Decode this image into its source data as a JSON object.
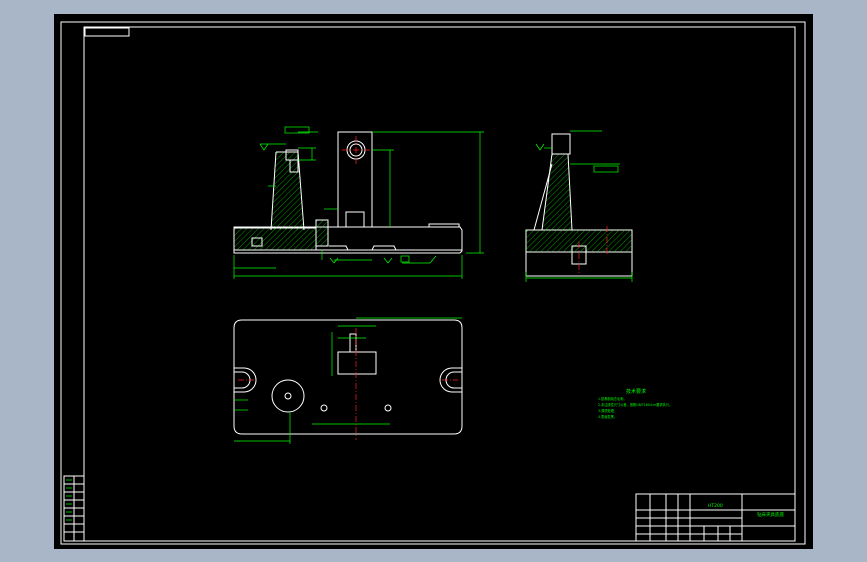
{
  "colors": {
    "outer_background": "#a9b6c8",
    "canvas": "#000000",
    "outline": "#ffffff",
    "dimension": "#00ff00",
    "centerline": "#ff2020"
  },
  "tech_requirements": {
    "title": "技术要求",
    "items": [
      "1.锐角倒钝去毛刺。",
      "2.未注线性尺寸公差，按照GB/T1804-m要求执行。",
      "3.调质处理。",
      "4.表面发黑。"
    ]
  },
  "title_block": {
    "material": "HT200",
    "drawing_name": "钻床夹具底座"
  }
}
